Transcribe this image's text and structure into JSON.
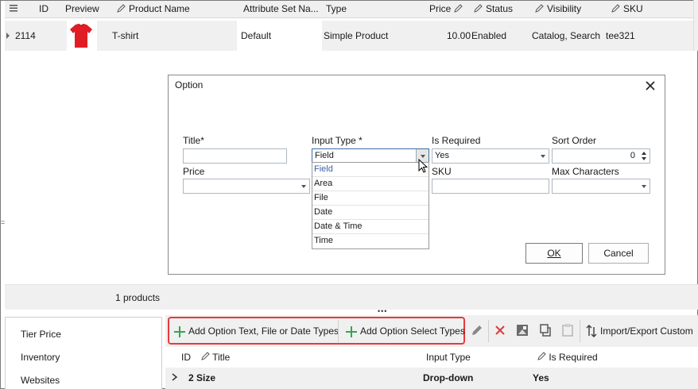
{
  "grid": {
    "columns": [
      "ID",
      "Preview",
      "Product Name",
      "Attribute Set Na...",
      "Type",
      "Price",
      "Status",
      "Visibility",
      "SKU"
    ],
    "row": {
      "id": "2114",
      "product_name": "T-shirt",
      "attribute_set": "Default",
      "type": "Simple Product",
      "price": "10.00",
      "status": "Enabled",
      "visibility": "Catalog, Search",
      "sku": "tee321"
    },
    "products_count": "1 products"
  },
  "dialog": {
    "title": "Option",
    "labels": {
      "title": "Title*",
      "input_type": "Input Type *",
      "is_required": "Is Required",
      "sort_order": "Sort Order",
      "price": "Price",
      "sku": "SKU",
      "max_characters": "Max Characters"
    },
    "values": {
      "title": "",
      "input_type": "Field",
      "is_required": "Yes",
      "sort_order": "0",
      "price": "",
      "sku": "",
      "max_characters": ""
    },
    "input_type_options": [
      "Field",
      "Area",
      "File",
      "Date",
      "Date & Time",
      "Time"
    ],
    "ok_label": "OK",
    "cancel_label": "Cancel"
  },
  "bottom": {
    "nav_items": [
      "Tier Price",
      "Inventory",
      "Websites"
    ],
    "toolbar": {
      "add_text_label": "Add Option Text, File or Date Types",
      "add_select_label": "Add Option Select Types",
      "import_export_label": "Import/Export Custom"
    },
    "subgrid_columns": [
      "ID",
      "Title",
      "Input Type",
      "Is Required"
    ],
    "subgrid_row": {
      "title": "2 Size",
      "input_type": "Drop-down",
      "is_required": "Yes"
    }
  },
  "colors": {
    "highlight": "#e8383d",
    "add_green": "#2fa84f",
    "delete_red": "#e03a3a",
    "tshirt_red": "#e01d25"
  }
}
